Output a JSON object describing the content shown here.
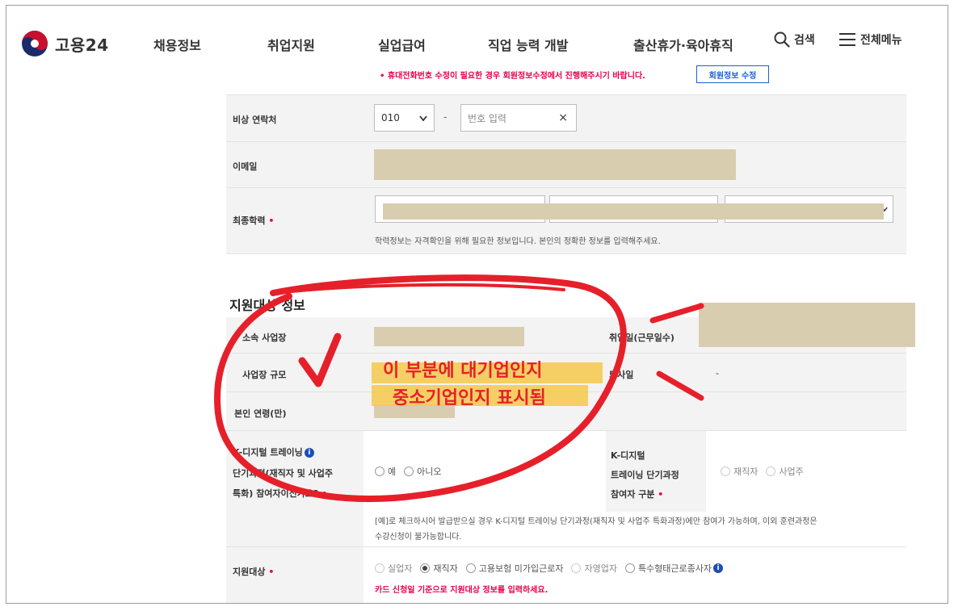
{
  "header": {
    "brand": "고용24",
    "nav": [
      "채용정보",
      "취업지원",
      "실업급여",
      "직업 능력 개발",
      "출산휴가·육아휴직"
    ],
    "search_label": "검색",
    "menu_label": "전체메뉴"
  },
  "contact": {
    "phone_notice": "• 휴대전화번호 수정이 필요한 경우 회원정보수정에서 진행해주시기 바랍니다.",
    "edit_member_button": "회원정보 수정",
    "emergency_label": "비상 연락처",
    "emergency_prefix": "010",
    "emergency_dash": "-",
    "emergency_placeholder": "번호 입력",
    "clear_glyph": "×",
    "email_label": "이메일",
    "education_label": "최종학력",
    "education_help": "학력정보는 자격확인을 위해 필요한 정보입니다. 본인의 정확한 정보를 입력해주세요."
  },
  "support": {
    "title": "지원대상 정보",
    "workplace_label": "소속 사업장",
    "hire_date_label": "취업일(근무일수)",
    "workplace_size_label": "사업장 규모",
    "resign_label": "퇴사일",
    "resign_value": "-",
    "age_label": "본인 연령(만)",
    "kdigital_label_1": "K-디지털 트레이닝",
    "kdigital_label_2": "단기과정(재직자 및 사업주",
    "kdigital_label_3": "특화) 참여자이신가요?",
    "yes": "예",
    "no": "아니오",
    "participant_label_1": "K-디지털",
    "participant_label_2": "트레이닝 단기과정",
    "participant_label_3": "참여자 구분",
    "employee": "재직자",
    "employer": "사업주",
    "kdigital_help_1": "[예]로 체크하시어 발급받으실 경우 K-디지털 트레이닝 단기과정(재직자 및 사업주 특화과정)에만 참여가 가능하며, 이외 훈련과정은",
    "kdigital_help_2": "수강신청이 불가능합니다.",
    "target_label": "지원대상",
    "targets": [
      "실업자",
      "재직자",
      "고용보험 미가입근로자",
      "자영업자",
      "특수형태근로종사자"
    ],
    "target_notice": "카드 신청일 기준으로 지원대상 정보를 입력하세요."
  },
  "annotation": {
    "line1": "이 부분에 대기업인지",
    "line2": "중소기업인지 표시됨"
  },
  "colors": {
    "required": "#e6004c",
    "accent_blue": "#1b5fd1",
    "annotation_red": "#e6202a",
    "highlight_yellow": "#f6c84a",
    "redaction": "#d9cdb0"
  }
}
